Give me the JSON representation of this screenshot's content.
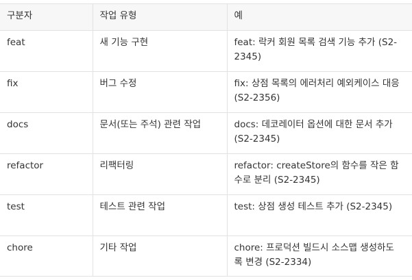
{
  "table": {
    "headers": [
      "구분자",
      "작업 유형",
      "예"
    ],
    "rows": [
      {
        "type": "feat",
        "desc": "새 기능 구현",
        "example": "feat: 락커 회원 목록 검색 기능 추가 (S2-2345)"
      },
      {
        "type": "fix",
        "desc": "버그 수정",
        "example": "fix: 상점 목록의 에러처리 예외케이스 대응 (S2-2356)"
      },
      {
        "type": "docs",
        "desc": "문서(또는 주석) 관련 작업",
        "example": "docs: 데코레이터 옵션에 대한 문서 추가 (S2-2345)"
      },
      {
        "type": "refactor",
        "desc": "리팩터링",
        "example": "refactor: createStore의 함수를 작은 함수로 분리 (S2-2345)"
      },
      {
        "type": "test",
        "desc": "테스트 관련 작업",
        "example": "test: 상점 생성 테스트 추가 (S2-2345)"
      },
      {
        "type": "chore",
        "desc": "기타 작업",
        "example": "chore: 프로덕션 빌드시 소스맵 생성하도록 변경 (S2-2334)"
      }
    ]
  }
}
